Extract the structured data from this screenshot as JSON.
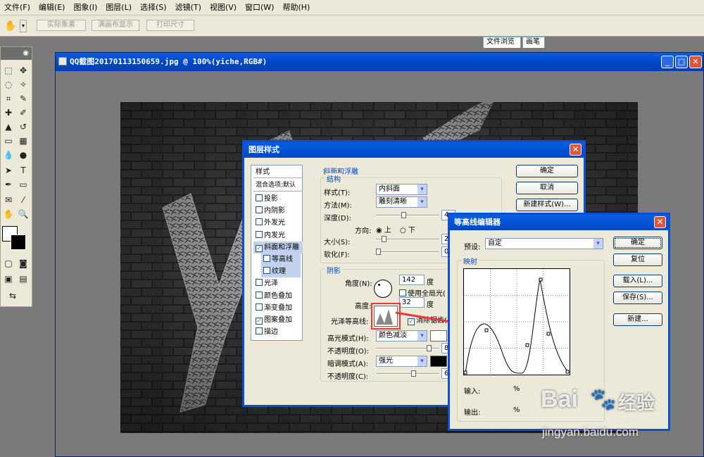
{
  "menu": [
    "文件(F)",
    "编辑(E)",
    "图象(I)",
    "图层(L)",
    "选择(S)",
    "滤镜(T)",
    "视图(V)",
    "窗口(W)",
    "帮助(H)"
  ],
  "options": {
    "btn1": "实际象素",
    "btn2": "满画布显示",
    "btn3": "打印尺寸"
  },
  "palette_tabs": [
    "文件浏览",
    "画笔"
  ],
  "document": {
    "title": "QQ截图20170113150659.jpg @ 100%(yiche,RGB#)"
  },
  "layer_style": {
    "title": "图层样式",
    "list_header": "样式",
    "blend_item": "混合选项:默认",
    "items": [
      {
        "label": "投影",
        "checked": false
      },
      {
        "label": "内阴影",
        "checked": false
      },
      {
        "label": "外发光",
        "checked": false
      },
      {
        "label": "内发光",
        "checked": false
      },
      {
        "label": "斜面和浮雕",
        "checked": true
      },
      {
        "label": "等高线",
        "checked": false
      },
      {
        "label": "纹理",
        "checked": false
      },
      {
        "label": "光泽",
        "checked": false
      },
      {
        "label": "颜色叠加",
        "checked": false
      },
      {
        "label": "渐变叠加",
        "checked": false
      },
      {
        "label": "图案叠加",
        "checked": true
      },
      {
        "label": "描边",
        "checked": false
      }
    ],
    "bevel_group": "斜面和浮雕",
    "structure_group": "结构",
    "style_label": "样式(T):",
    "style_value": "内斜面",
    "technique_label": "方法(M):",
    "technique_value": "雕刻清晰",
    "depth_label": "深度(D):",
    "depth_value": "4",
    "direction_label": "方向:",
    "dir_up": "上",
    "dir_down": "下",
    "size_label": "大小(S):",
    "size_value": "2",
    "soften_label": "软化(F):",
    "soften_value": "0",
    "shading_group": "阴影",
    "angle_label": "角度(N):",
    "angle_value": "142",
    "angle_unit": "度",
    "global_light": "使用全局光(",
    "altitude_label": "高度:",
    "altitude_value": "32",
    "altitude_unit": "度",
    "gloss_label": "光泽等高线:",
    "antialias": "消除锯齿(",
    "highlight_label": "高光模式(H):",
    "highlight_value": "颜色减淡",
    "opacity1_label": "不透明度(O):",
    "opacity1_value": "8",
    "shadow_label": "暗调模式(A):",
    "shadow_value": "强光",
    "opacity2_label": "不透明度(C):",
    "opacity2_value": "6",
    "ok": "确定",
    "cancel": "取消",
    "new_style": "新建样式(W)..."
  },
  "contour_editor": {
    "title": "等高线编辑器",
    "preset_label": "预设:",
    "preset_value": "自定",
    "mapping_group": "映射",
    "input_label": "输入:",
    "input_unit": "%",
    "output_label": "输出:",
    "output_unit": "%",
    "ok": "确定",
    "reset": "复位",
    "load": "载入(L)...",
    "save": "保存(S)...",
    "new": "新建..."
  },
  "watermark": {
    "brand": "Bai",
    "brand2": "经验",
    "url": "jingyan.baidu.com"
  },
  "colors": {
    "titlebar": "#0047c8",
    "dialog_bg": "#ece9d8",
    "arrow": "#e83a3a",
    "selected": "#c1d2ee"
  }
}
